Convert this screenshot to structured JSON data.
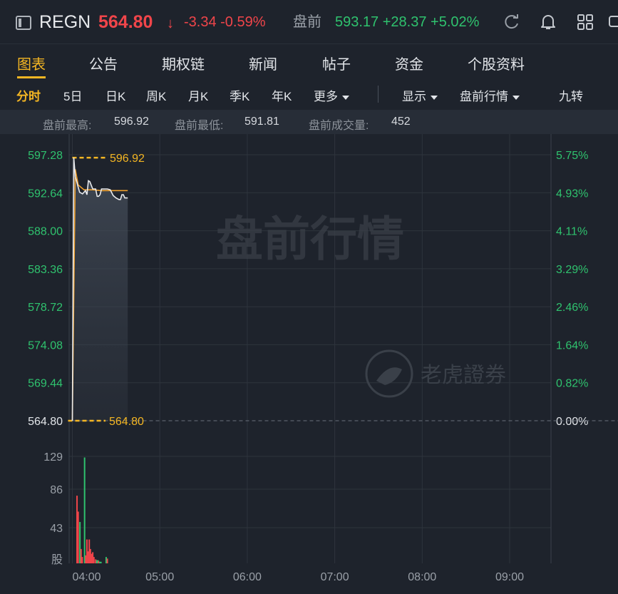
{
  "header": {
    "ticker": "REGN",
    "price": "564.80",
    "price_arrow": "↓",
    "change": "-3.34 -0.59%",
    "premarket_label": "盘前",
    "premarket_price": "593.17 +28.37 +5.02%",
    "colors": {
      "down": "#f0454a",
      "up": "#2fc26e",
      "accent": "#f4b623"
    },
    "icons": [
      "sidebar-toggle-icon",
      "refresh-icon",
      "bell-icon",
      "grid-icon",
      "expand-icon"
    ]
  },
  "tabs": [
    {
      "label": "图表",
      "active": true
    },
    {
      "label": "公告"
    },
    {
      "label": "期权链"
    },
    {
      "label": "新闻"
    },
    {
      "label": "帖子"
    },
    {
      "label": "资金"
    },
    {
      "label": "个股资料"
    }
  ],
  "periods": {
    "items": [
      "分时",
      "5日",
      "日K",
      "周K",
      "月K",
      "季K",
      "年K"
    ],
    "active": "分时",
    "more": "更多",
    "display": "显示",
    "premarket_quote": "盘前行情",
    "nine_turn": "九转"
  },
  "stats": {
    "high_label": "盘前最高:",
    "high_value": "596.92",
    "low_label": "盘前最低:",
    "low_value": "591.81",
    "volume_label": "盘前成交量:",
    "volume_value": "452"
  },
  "chart_data": {
    "type": "line",
    "watermark": "盘前行情",
    "brand_watermark": "老虎證券",
    "y_ticks": [
      "597.28",
      "592.64",
      "588.00",
      "583.36",
      "578.72",
      "574.08",
      "569.44",
      "564.80"
    ],
    "pct_ticks": [
      "5.75%",
      "4.93%",
      "4.11%",
      "3.29%",
      "2.46%",
      "1.64%",
      "0.82%",
      "0.00%"
    ],
    "ylim": [
      564.8,
      597.28
    ],
    "x_ticks": [
      "04:00",
      "05:00",
      "06:00",
      "07:00",
      "08:00",
      "09:00"
    ],
    "high_marker": "596.92",
    "base_marker": "564.80",
    "price_series": {
      "x_minutes": [
        0,
        1,
        2,
        3,
        5,
        7,
        9,
        10,
        11,
        12,
        14,
        16,
        17,
        18,
        19,
        20,
        22,
        24,
        26,
        28,
        30,
        32,
        33,
        34,
        35,
        36,
        38
      ],
      "values": [
        564.8,
        596.92,
        594.6,
        594.0,
        592.7,
        592.5,
        592.9,
        592.4,
        594.1,
        594.0,
        593.1,
        593.1,
        592.2,
        592.2,
        592.4,
        593.1,
        593.1,
        593.1,
        593.0,
        592.3,
        592.0,
        591.81,
        591.81,
        592.4,
        592.4,
        592.0,
        592.0
      ]
    },
    "avg_series": {
      "x_minutes": [
        0,
        2,
        4,
        8,
        14,
        20,
        26,
        32,
        38
      ],
      "values": [
        564.8,
        595.5,
        593.6,
        593.0,
        593.0,
        592.9,
        592.9,
        592.9,
        592.9
      ]
    },
    "volume": {
      "y_ticks": [
        "129",
        "86",
        "43",
        "股"
      ],
      "ylim": [
        0,
        172
      ],
      "bars": [
        {
          "m": 8,
          "v": 85,
          "c": "down"
        },
        {
          "m": 10,
          "v": 65,
          "c": "down"
        },
        {
          "m": 13,
          "v": 52,
          "c": "up"
        },
        {
          "m": 15,
          "v": 18,
          "c": "down"
        },
        {
          "m": 17,
          "v": 8,
          "c": "down"
        },
        {
          "m": 21,
          "v": 133,
          "c": "up"
        },
        {
          "m": 23,
          "v": 10,
          "c": "down"
        },
        {
          "m": 25,
          "v": 30,
          "c": "down"
        },
        {
          "m": 27,
          "v": 15,
          "c": "down"
        },
        {
          "m": 29,
          "v": 30,
          "c": "down"
        },
        {
          "m": 31,
          "v": 18,
          "c": "down"
        },
        {
          "m": 33,
          "v": 12,
          "c": "down"
        },
        {
          "m": 35,
          "v": 14,
          "c": "down"
        },
        {
          "m": 37,
          "v": 8,
          "c": "down"
        },
        {
          "m": 40,
          "v": 5,
          "c": "down"
        },
        {
          "m": 42,
          "v": 4,
          "c": "up"
        },
        {
          "m": 44,
          "v": 4,
          "c": "up"
        },
        {
          "m": 45,
          "v": 3,
          "c": "down"
        },
        {
          "m": 47,
          "v": 2,
          "c": "up"
        },
        {
          "m": 49,
          "v": 2,
          "c": "up"
        },
        {
          "m": 58,
          "v": 8,
          "c": "up"
        },
        {
          "m": 60,
          "v": 6,
          "c": "down"
        }
      ]
    }
  }
}
